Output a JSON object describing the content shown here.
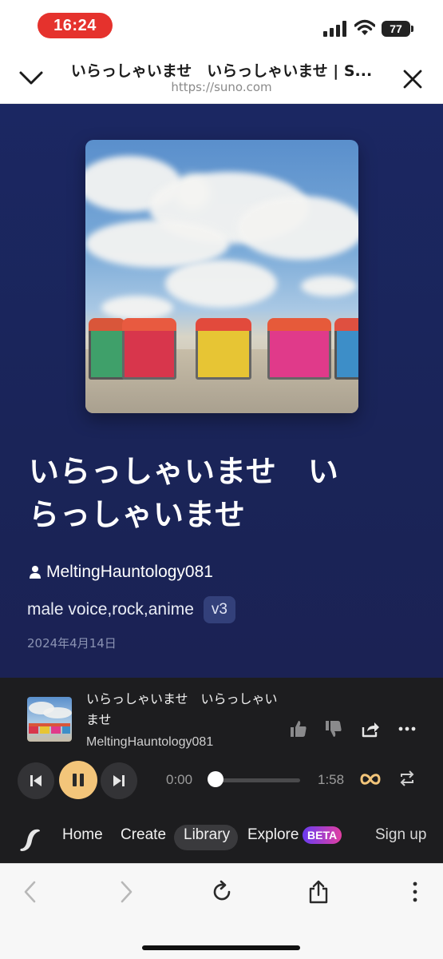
{
  "status_bar": {
    "time": "16:24",
    "battery": "77"
  },
  "browser": {
    "page_title": "いらっしゃいませ　いらっしゃいませ | S...",
    "url": "https://suno.com"
  },
  "song": {
    "title": "いらっしゃいませ　いらっしゃいませ",
    "artist": "MeltingHauntology081",
    "tags": "male voice,rock,anime",
    "version": "v3",
    "date": "2024年4月14日"
  },
  "player": {
    "title": "いらっしゃいませ　いらっしゃいませ",
    "artist": "MeltingHauntology081",
    "current_time": "0:00",
    "total_time": "1:58",
    "progress": 0,
    "state": "playing"
  },
  "nav": {
    "home": "Home",
    "create": "Create",
    "library": "Library",
    "explore": "Explore",
    "beta": "BETA",
    "signup": "Sign up"
  },
  "colors": {
    "accent": "#f3c57a",
    "song_background": "#1b2762",
    "player_background": "#1d1d1f",
    "time_pill": "#e5322d"
  },
  "icons": {
    "status": [
      "signal-icon",
      "wifi-icon",
      "battery-icon"
    ],
    "header": [
      "chevron-down-icon",
      "close-icon"
    ],
    "player": [
      "thumbs-up-icon",
      "thumbs-down-icon",
      "share-icon",
      "more-icon",
      "skip-back-icon",
      "pause-icon",
      "skip-forward-icon",
      "infinity-icon",
      "repeat-icon"
    ],
    "toolbar": [
      "back-icon",
      "forward-icon",
      "reload-icon",
      "share-icon",
      "more-vertical-icon"
    ]
  }
}
